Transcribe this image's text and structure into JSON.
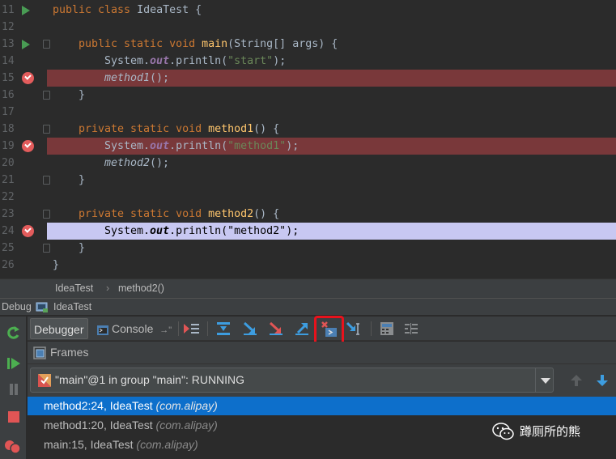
{
  "editor": {
    "lines": [
      {
        "num": "11",
        "marker": "run",
        "fold": false,
        "state": "normal",
        "indent": 0,
        "tokens": [
          [
            "kw",
            "public class "
          ],
          [
            "plain",
            "IdeaTest {"
          ]
        ]
      },
      {
        "num": "12",
        "marker": "",
        "fold": false,
        "state": "normal",
        "indent": 0,
        "tokens": []
      },
      {
        "num": "13",
        "marker": "run",
        "fold": true,
        "state": "normal",
        "indent": 1,
        "tokens": [
          [
            "kw",
            "public static void "
          ],
          [
            "fn",
            "main"
          ],
          [
            "plain",
            "(String[] args) {"
          ]
        ]
      },
      {
        "num": "14",
        "marker": "",
        "fold": false,
        "state": "normal",
        "indent": 2,
        "tokens": [
          [
            "plain",
            "System."
          ],
          [
            "fld",
            "out"
          ],
          [
            "plain",
            ".println("
          ],
          [
            "str",
            "\"start\""
          ],
          [
            "plain",
            ");"
          ]
        ]
      },
      {
        "num": "15",
        "marker": "breakpoint",
        "fold": false,
        "state": "breakpoint",
        "indent": 2,
        "tokens": [
          [
            "ital",
            "method1"
          ],
          [
            "plain",
            "();"
          ]
        ]
      },
      {
        "num": "16",
        "marker": "",
        "fold": true,
        "state": "normal",
        "indent": 1,
        "tokens": [
          [
            "plain",
            "}"
          ]
        ]
      },
      {
        "num": "17",
        "marker": "",
        "fold": false,
        "state": "normal",
        "indent": 0,
        "tokens": []
      },
      {
        "num": "18",
        "marker": "",
        "fold": true,
        "state": "normal",
        "indent": 1,
        "tokens": [
          [
            "kw",
            "private static void "
          ],
          [
            "fn",
            "method1"
          ],
          [
            "plain",
            "() {"
          ]
        ]
      },
      {
        "num": "19",
        "marker": "breakpoint",
        "fold": false,
        "state": "breakpoint",
        "indent": 2,
        "tokens": [
          [
            "plain",
            "System."
          ],
          [
            "fld",
            "out"
          ],
          [
            "plain",
            ".println("
          ],
          [
            "str",
            "\"method1\""
          ],
          [
            "plain",
            ");"
          ]
        ]
      },
      {
        "num": "20",
        "marker": "",
        "fold": false,
        "state": "normal",
        "indent": 2,
        "tokens": [
          [
            "ital",
            "method2"
          ],
          [
            "plain",
            "();"
          ]
        ]
      },
      {
        "num": "21",
        "marker": "",
        "fold": true,
        "state": "normal",
        "indent": 1,
        "tokens": [
          [
            "plain",
            "}"
          ]
        ]
      },
      {
        "num": "22",
        "marker": "",
        "fold": false,
        "state": "normal",
        "indent": 0,
        "tokens": []
      },
      {
        "num": "23",
        "marker": "",
        "fold": true,
        "state": "normal",
        "indent": 1,
        "tokens": [
          [
            "kw",
            "private static void "
          ],
          [
            "fn",
            "method2"
          ],
          [
            "plain",
            "() {"
          ]
        ]
      },
      {
        "num": "24",
        "marker": "breakpoint",
        "fold": false,
        "state": "current",
        "indent": 2,
        "tokens": [
          [
            "plain",
            "System."
          ],
          [
            "fld",
            "out"
          ],
          [
            "plain",
            ".println("
          ],
          [
            "str",
            "\"method2\""
          ],
          [
            "plain",
            ");"
          ]
        ]
      },
      {
        "num": "25",
        "marker": "",
        "fold": true,
        "state": "normal",
        "indent": 1,
        "tokens": [
          [
            "plain",
            "}"
          ]
        ]
      },
      {
        "num": "26",
        "marker": "",
        "fold": false,
        "state": "normal",
        "indent": 0,
        "tokens": [
          [
            "plain",
            "}"
          ]
        ]
      }
    ]
  },
  "breadcrumb": {
    "items": [
      "IdeaTest",
      "method2()"
    ],
    "separator": "›"
  },
  "debug_window": {
    "title": "Debug",
    "session": "IdeaTest"
  },
  "debug_toolbar": {
    "tabs": [
      {
        "label": "Debugger",
        "active": true
      },
      {
        "label": "Console",
        "active": false
      }
    ],
    "console_pin": "→\"",
    "highlight_color": "#e8121c"
  },
  "frames": {
    "header": "Frames",
    "thread": "\"main\"@1 in group \"main\": RUNNING",
    "items": [
      {
        "method": "method2:24, IdeaTest ",
        "pkg": "(com.alipay)",
        "selected": true
      },
      {
        "method": "method1:20, IdeaTest ",
        "pkg": "(com.alipay)",
        "selected": false
      },
      {
        "method": "main:15, IdeaTest ",
        "pkg": "(com.alipay)",
        "selected": false
      }
    ]
  },
  "watermark": {
    "text": "蹲厕所的熊",
    "icon": "wechat-icon"
  },
  "colors": {
    "breakpoint_line": "#79383a",
    "current_line": "#c8c8f2",
    "selected_frame": "#0d6fcb",
    "accent_green": "#499c54"
  }
}
